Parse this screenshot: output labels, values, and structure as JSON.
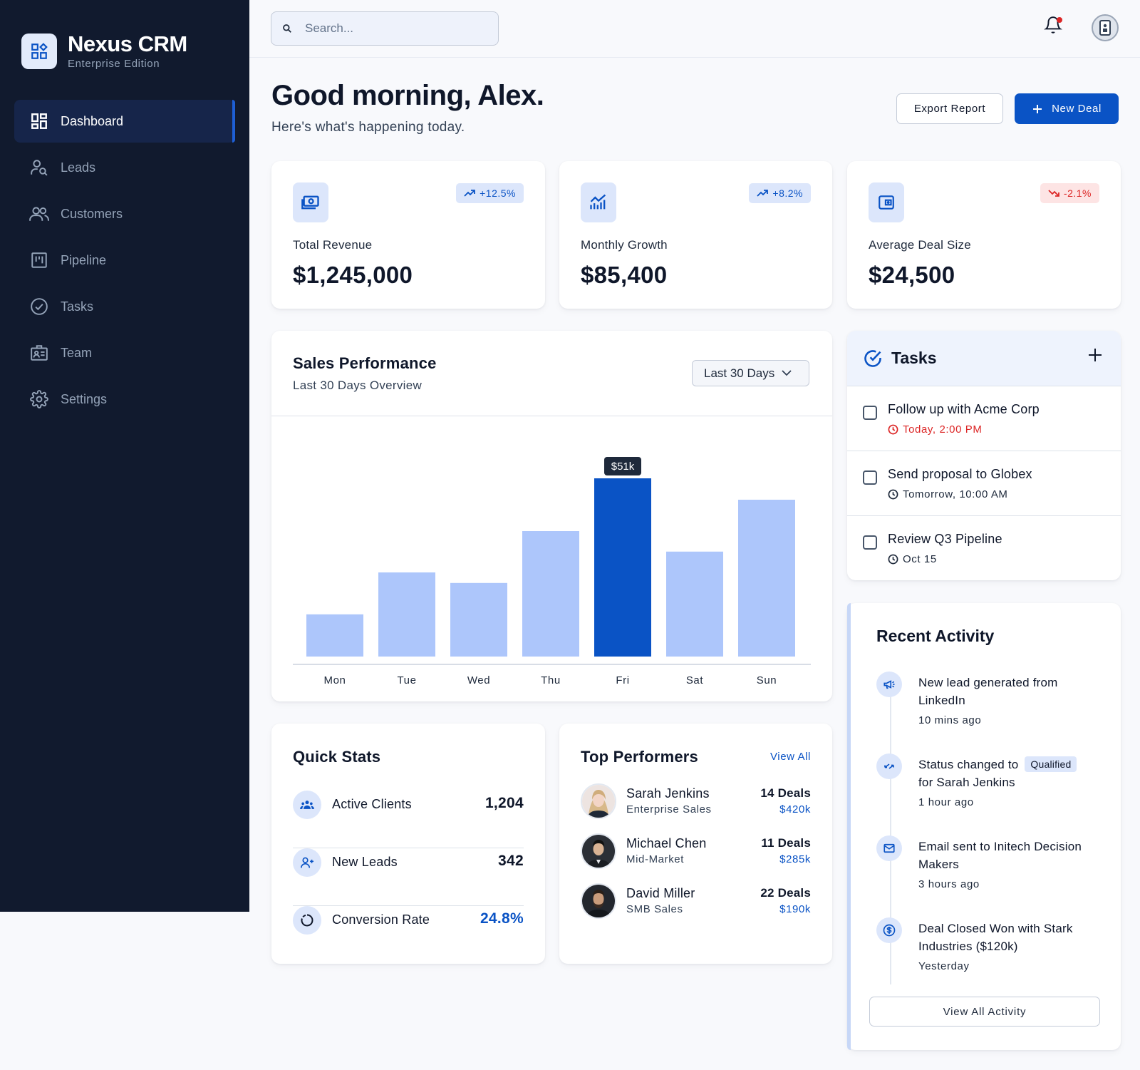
{
  "brand": {
    "name": "Nexus CRM",
    "edition": "Enterprise Edition"
  },
  "sidebar": {
    "items": [
      {
        "label": "Dashboard",
        "icon": "dashboard-icon",
        "active": true
      },
      {
        "label": "Leads",
        "icon": "leads-icon"
      },
      {
        "label": "Customers",
        "icon": "customers-icon"
      },
      {
        "label": "Pipeline",
        "icon": "pipeline-icon"
      },
      {
        "label": "Tasks",
        "icon": "tasks-icon"
      },
      {
        "label": "Team",
        "icon": "team-icon"
      },
      {
        "label": "Settings",
        "icon": "settings-icon"
      }
    ]
  },
  "topbar": {
    "search_placeholder": "Search...",
    "has_notification": true
  },
  "header": {
    "greeting": "Good morning, Alex.",
    "subtitle": "Here's what's happening today.",
    "export_label": "Export Report",
    "new_deal_label": "New Deal"
  },
  "stats": [
    {
      "label": "Total Revenue",
      "value": "$1,245,000",
      "trend": "+12.5%",
      "direction": "up",
      "icon": "revenue-icon"
    },
    {
      "label": "Monthly Growth",
      "value": "$85,400",
      "trend": "+8.2%",
      "direction": "up",
      "icon": "growth-chart-icon"
    },
    {
      "label": "Average Deal Size",
      "value": "$24,500",
      "trend": "-2.1%",
      "direction": "down",
      "icon": "wallet-icon"
    }
  ],
  "sales_performance": {
    "title": "Sales Performance",
    "subtitle": "Last 30 Days Overview",
    "range": "Last 30 Days"
  },
  "chart_data": {
    "type": "bar",
    "categories": [
      "Mon",
      "Tue",
      "Wed",
      "Thu",
      "Fri",
      "Sat",
      "Sun"
    ],
    "values": [
      14.8,
      29.5,
      25.8,
      44,
      62.5,
      36.8,
      55
    ],
    "highlight_index": 4,
    "highlight_label": "$51k",
    "colors": {
      "bar": "#adc6fb",
      "highlight": "#0a53c5",
      "tooltip": "#1e293b"
    }
  },
  "tasks": {
    "title": "Tasks",
    "items": [
      {
        "title": "Follow up with Acme Corp",
        "due": "Today, 2:00 PM",
        "urgent": true
      },
      {
        "title": "Send proposal to Globex",
        "due": "Tomorrow, 10:00 AM",
        "urgent": false
      },
      {
        "title": "Review Q3 Pipeline",
        "due": "Oct 15",
        "urgent": false
      }
    ]
  },
  "activity": {
    "title": "Recent Activity",
    "view_all_label": "View All Activity",
    "items": [
      {
        "lead": "New lead",
        "rest": " generated from LinkedIn",
        "badge": "",
        "suffix": "",
        "time": "10 mins ago",
        "icon": "megaphone-icon"
      },
      {
        "lead": "Status changed",
        "rest": " to",
        "badge": "Qualified",
        "suffix": "for Sarah Jenkins",
        "time": "1 hour ago",
        "icon": "swap-icon"
      },
      {
        "lead": "Email sent",
        "rest": " to Initech Decision Makers",
        "badge": "",
        "suffix": "",
        "time": "3 hours ago",
        "icon": "mail-icon"
      },
      {
        "lead": "Deal Closed Won",
        "rest": " with Stark Industries ($120k)",
        "badge": "",
        "suffix": "",
        "time": "Yesterday",
        "icon": "dollar-icon"
      }
    ]
  },
  "quick_stats": {
    "title": "Quick Stats",
    "items": [
      {
        "label": "Active Clients",
        "value": "1,204",
        "icon": "group-icon"
      },
      {
        "label": "New Leads",
        "value": "342",
        "icon": "add-person-icon"
      },
      {
        "label": "Conversion Rate",
        "value": "24.8%",
        "icon": "progress-ring-icon",
        "accent": true
      }
    ]
  },
  "top_performers": {
    "title": "Top Performers",
    "view_all_label": "View All",
    "items": [
      {
        "name": "Sarah Jenkins",
        "role": "Enterprise Sales",
        "deals": "14 Deals",
        "amount": "$420k"
      },
      {
        "name": "Michael Chen",
        "role": "Mid-Market",
        "deals": "11 Deals",
        "amount": "$285k"
      },
      {
        "name": "David Miller",
        "role": "SMB Sales",
        "deals": "22 Deals",
        "amount": "$190k"
      }
    ]
  }
}
